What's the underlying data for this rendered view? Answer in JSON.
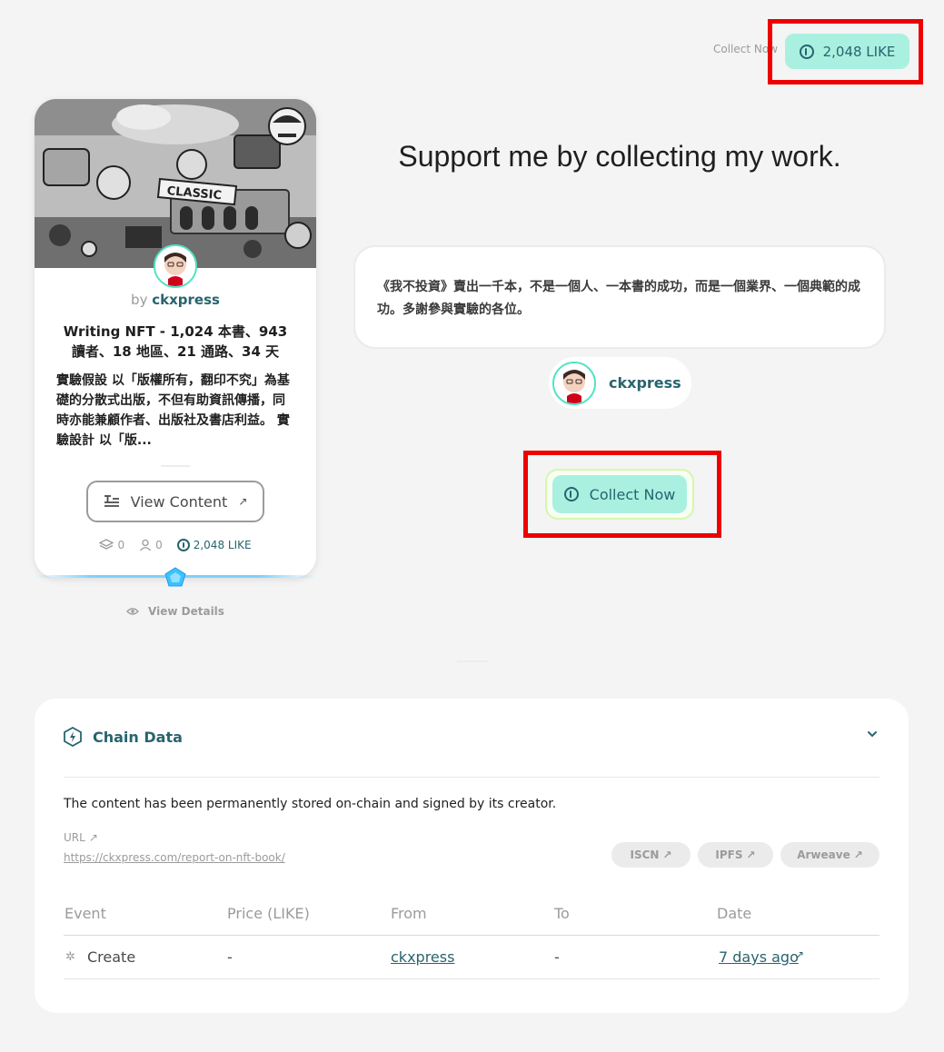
{
  "header": {
    "collect_now_text": "Collect Now",
    "like_count": "2,048 LIKE"
  },
  "card": {
    "by_prefix": "by",
    "creator": "ckxpress",
    "cover_text": "CLASSIC",
    "title": "Writing NFT - 1,024 本書、943 讀者、18 地區、21 通路、34 天——...",
    "description": "實驗假設 以「版權所有，翻印不究」為基礎的分散式出版，不但有助資訊傳播，同時亦能兼顧作者、出版社及書店利益。 實驗設計 以「版...",
    "view_content_label": "View Content",
    "stats": {
      "layers": "0",
      "owners": "0",
      "likes": "2,048 LIKE"
    },
    "view_details_label": "View Details"
  },
  "support": {
    "heading": "Support me by collecting my work.",
    "message": "《我不投資》賣出一千本，不是一個人、一本書的成功，而是一個業界、一個典範的成功。多謝參與實驗的各位。",
    "creator": "ckxpress",
    "collect_now_label": "Collect Now"
  },
  "chain_data": {
    "title": "Chain Data",
    "description": "The content has been permanently stored on-chain and signed by its creator.",
    "url_label": "URL",
    "url": "https://ckxpress.com/report-on-nft-book/",
    "tags": [
      "ISCN",
      "IPFS",
      "Arweave"
    ],
    "table": {
      "columns": [
        "Event",
        "Price (LIKE)",
        "From",
        "To",
        "Date"
      ],
      "rows": [
        {
          "event": "Create",
          "price": "-",
          "from": "ckxpress",
          "to": "-",
          "date": "7 days ago"
        }
      ]
    }
  },
  "colors": {
    "accent": "#28646e",
    "like_button_bg": "#aaf0e1",
    "highlight": "#ee0000",
    "page_bg": "#f4f4f4"
  }
}
